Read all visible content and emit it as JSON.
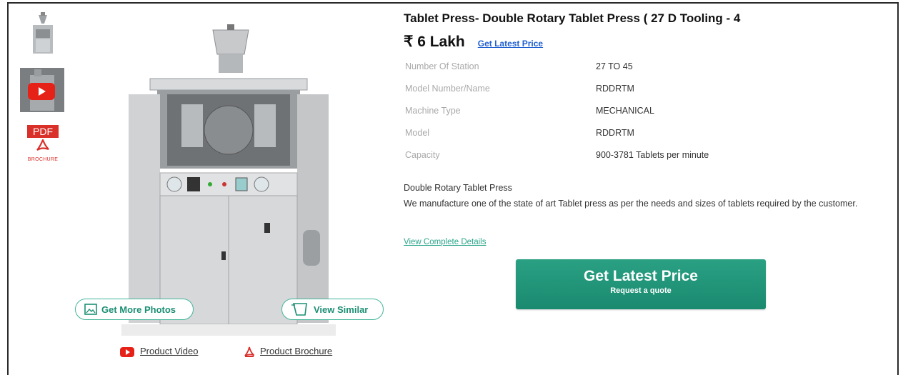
{
  "product": {
    "title": "Tablet Press- Double Rotary Tablet Press ( 27 D Tooling - 4",
    "price": "₹ 6 Lakh",
    "get_latest_price_link": "Get Latest Price"
  },
  "specs": [
    {
      "label": "Number Of Station",
      "value": "27 TO 45"
    },
    {
      "label": "Model Number/Name",
      "value": "RDDRTM"
    },
    {
      "label": "Machine Type",
      "value": "MECHANICAL"
    },
    {
      "label": "Model",
      "value": "RDDRTM"
    },
    {
      "label": "Capacity",
      "value": "900-3781 Tablets per minute"
    }
  ],
  "description": {
    "heading": "Double Rotary Tablet Press",
    "body": "We manufacture one of the state of art Tablet press as per the needs and sizes of tablets required by the customer."
  },
  "view_details": "View Complete Details",
  "cta": {
    "label": "Get Latest Price",
    "sublabel": "Request a quote",
    "color": "#1f9478"
  },
  "gallery": {
    "pdf_label": "PDF",
    "pdf_sub": "BROCHURE",
    "get_more_photos": "Get More Photos",
    "view_similar": "View Similar"
  },
  "links": {
    "product_video": "Product Video",
    "product_brochure": "Product Brochure"
  }
}
